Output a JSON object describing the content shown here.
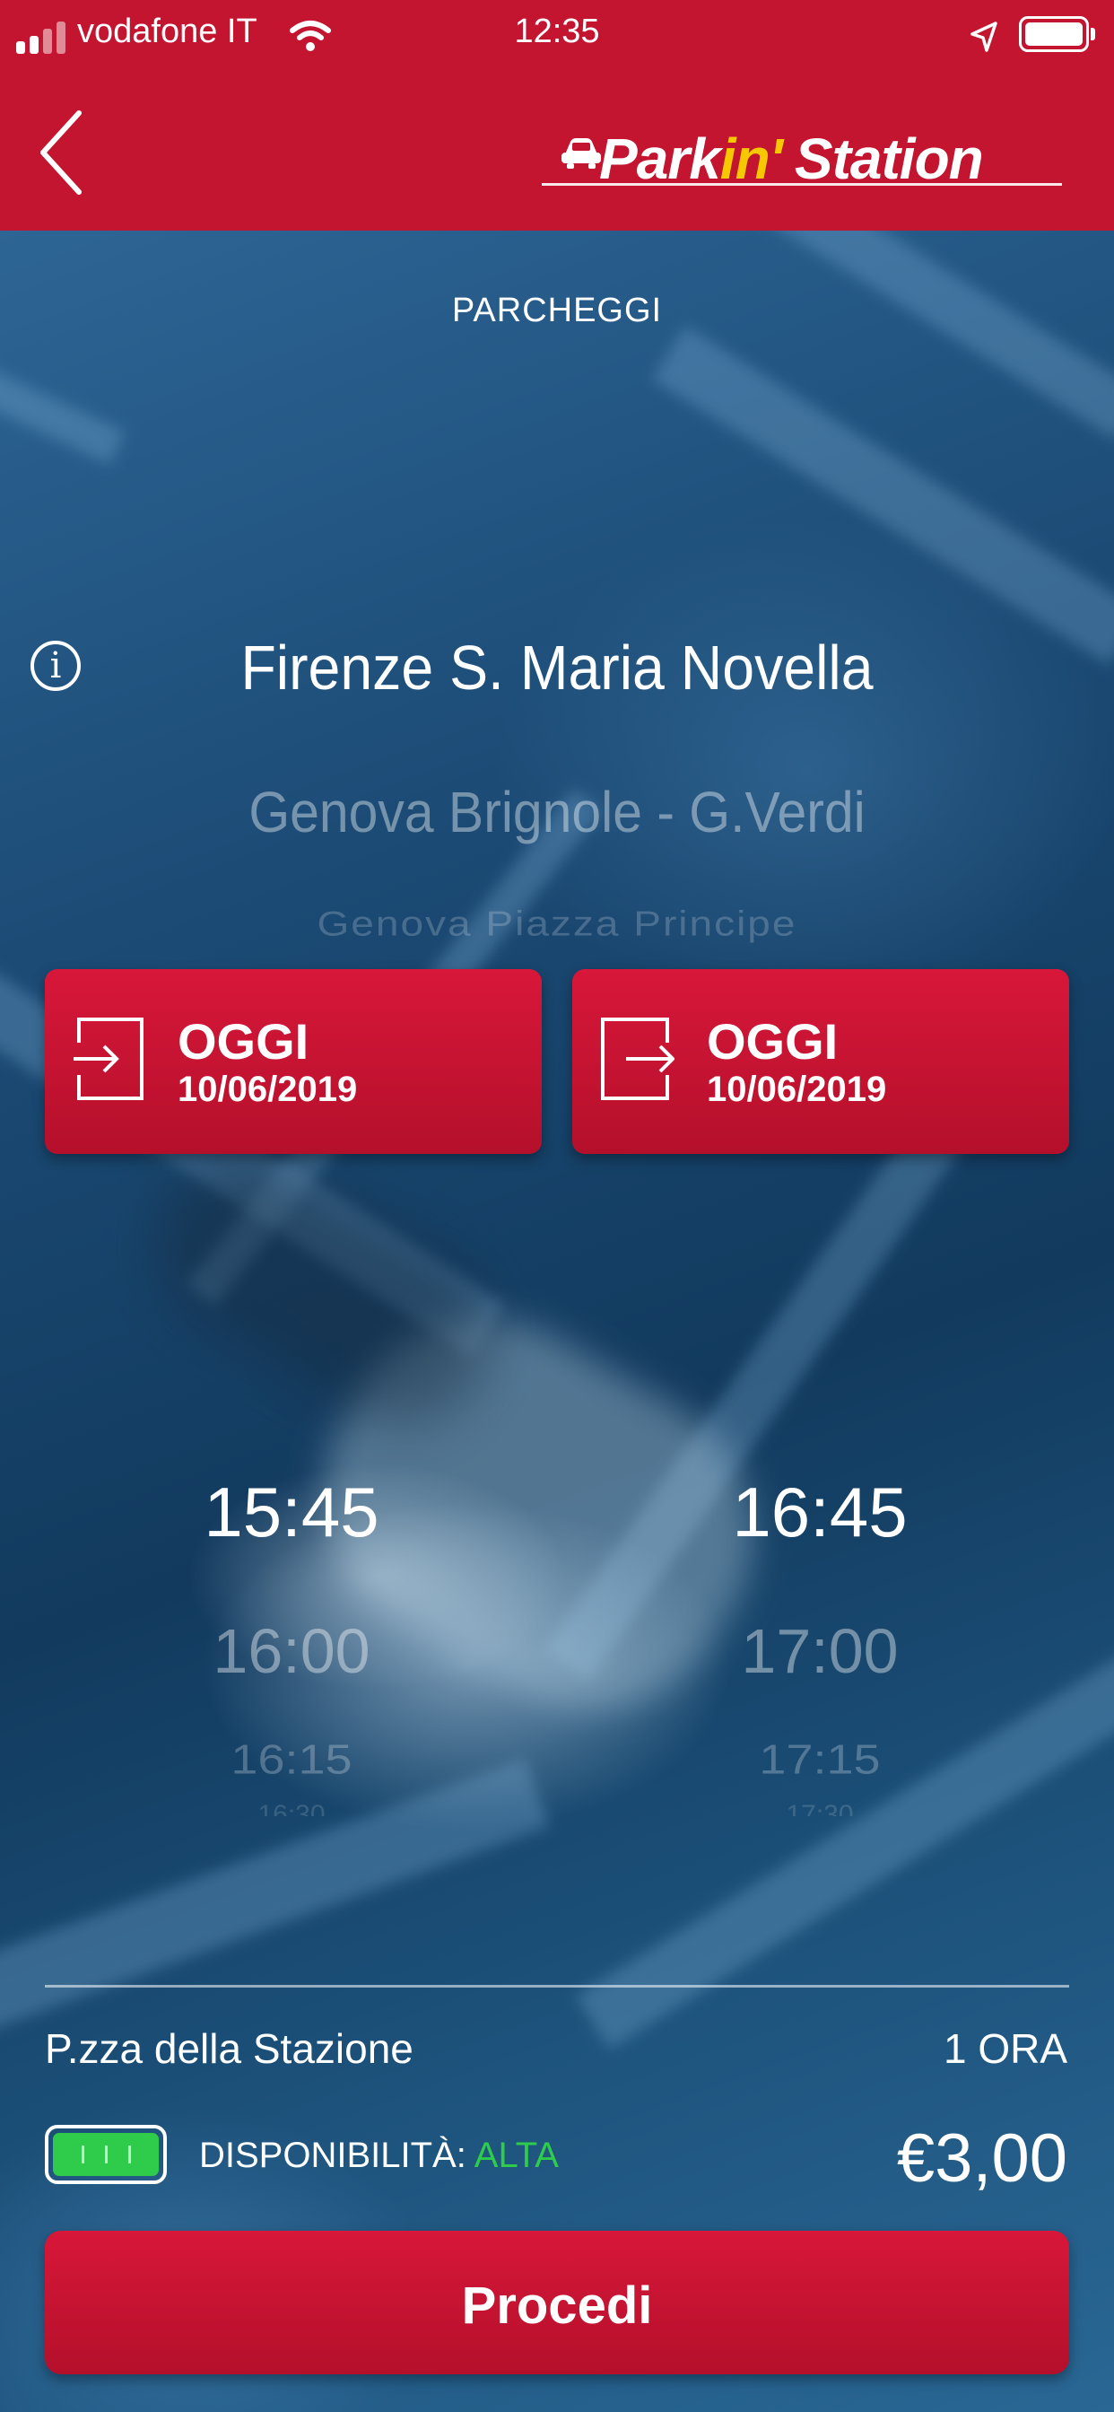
{
  "status_bar": {
    "carrier": "vodafone IT",
    "time": "12:35"
  },
  "header": {
    "brand_part1": "Park",
    "brand_part2": "in'",
    "brand_part3": "Station"
  },
  "screen_title": "PARCHEGGI",
  "location_picker": {
    "selected": "Firenze S. Maria Novella",
    "next": "Genova Brignole - G.Verdi",
    "next2": "Genova Piazza Principe"
  },
  "entry": {
    "label": "OGGI",
    "date": "10/06/2019"
  },
  "exit": {
    "label": "OGGI",
    "date": "10/06/2019"
  },
  "entry_times": [
    "15:45",
    "16:00",
    "16:15",
    "16:30"
  ],
  "exit_times": [
    "16:45",
    "17:00",
    "17:15",
    "17:30"
  ],
  "summary": {
    "parking_name": "P.zza della Stazione",
    "duration": "1 ORA",
    "availability_label": "DISPONIBILITÀ:",
    "availability_value": "ALTA",
    "availability_level": 1.0,
    "price": "€3,00"
  },
  "proceed_label": "Procedi",
  "colors": {
    "brand_red": "#c31430",
    "availability_green": "#2ecc4a",
    "brand_yellow": "#f6c800"
  }
}
